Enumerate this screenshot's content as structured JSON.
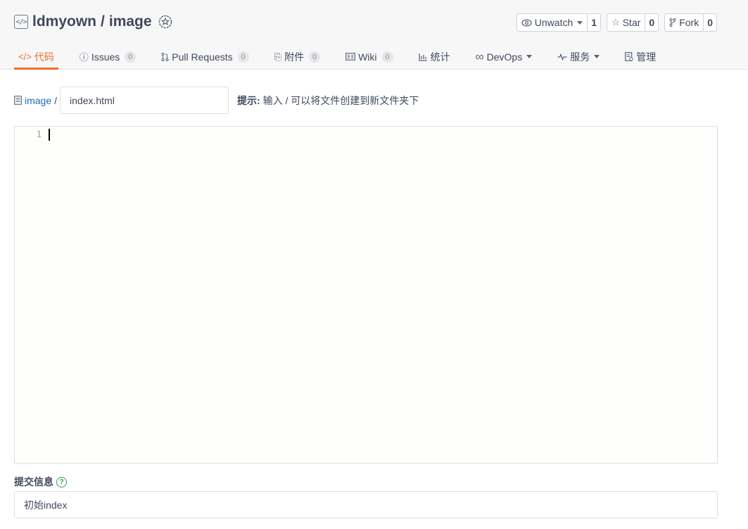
{
  "repo": {
    "owner": "ldmyown",
    "separator": "/",
    "name": "image"
  },
  "actions": {
    "watch": {
      "label": "Unwatch",
      "count": "1"
    },
    "star": {
      "label": "Star",
      "count": "0"
    },
    "fork": {
      "label": "Fork",
      "count": "0"
    }
  },
  "tabs": [
    {
      "label": "代码",
      "icon": "code-icon",
      "active": true
    },
    {
      "label": "Issues",
      "count": "0",
      "icon": "issue-icon"
    },
    {
      "label": "Pull Requests",
      "count": "0",
      "icon": "pull-request-icon"
    },
    {
      "label": "附件",
      "count": "0",
      "icon": "attachment-icon"
    },
    {
      "label": "Wiki",
      "count": "0",
      "icon": "wiki-icon"
    },
    {
      "label": "统计",
      "icon": "chart-icon"
    },
    {
      "label": "DevOps",
      "icon": "infinity-icon",
      "dropdown": true
    },
    {
      "label": "服务",
      "icon": "pulse-icon",
      "dropdown": true
    },
    {
      "label": "管理",
      "icon": "settings-doc-icon"
    }
  ],
  "path": {
    "repo_link": "image",
    "separator": "/",
    "filename": "index.html",
    "hint_prefix": "提示:",
    "hint_text": "输入 / 可以将文件创建到新文件夹下"
  },
  "editor": {
    "line_number": "1"
  },
  "commit": {
    "label": "提交信息",
    "value": "初始index"
  },
  "colors": {
    "accent": "#ee6e2d",
    "link": "#1f6fb5",
    "help": "#2aa345"
  }
}
